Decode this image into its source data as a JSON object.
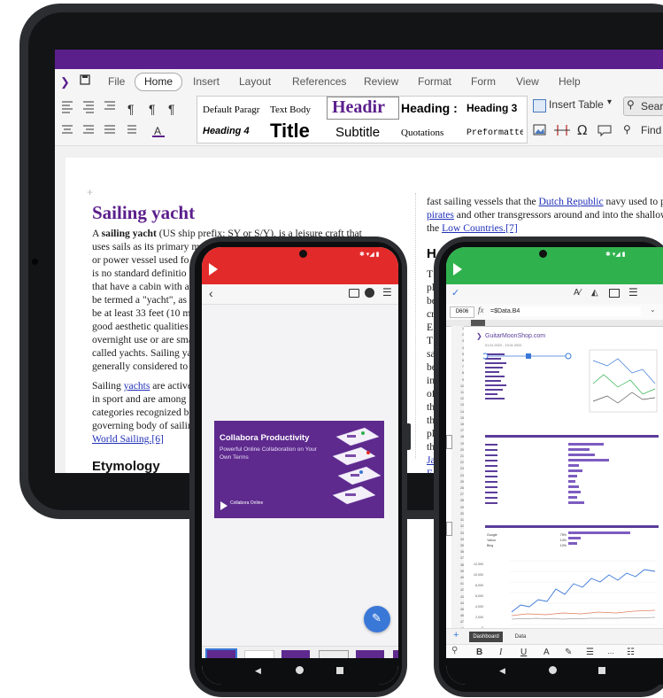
{
  "tablet": {
    "menu": [
      "File",
      "Home",
      "Insert",
      "Layout",
      "References",
      "Review",
      "Format",
      "Form",
      "View",
      "Help"
    ],
    "styles": {
      "default_paragraph": "Default Paragr",
      "text_body": "Text Body",
      "heading": "Headir",
      "heading2": "Heading :",
      "heading3": "Heading 3",
      "heading4": "Heading 4",
      "title": "Title",
      "subtitle": "Subtitle",
      "quotations": "Quotations",
      "preformatted": "Preformatted"
    },
    "insert_table": "Insert Table",
    "search": "Sear",
    "find": "Find",
    "doc": {
      "heading": "Sailing yacht",
      "para1_lines": [
        "A sailing yacht (US ship prefix: SY or S/Y), is a leisure craft that",
        "uses sails as its primary m",
        "or power vessel used fo",
        "is no standard definitio",
        "that have a cabin with a",
        "be termed a \"yacht\", as c",
        "be at least 33 feet (10 m",
        "good aesthetic qualities.",
        "overnight use or are sma",
        "called yachts. Sailing ya",
        "generally considered to"
      ],
      "para2_lines": [
        "Sailing yachts are active",
        "in sport and are among",
        "categories recognized by",
        "governing body of sailin",
        "World Sailing.[6]"
      ],
      "etymology": "Etymology",
      "right_lines": [
        "fast sailing vessels that the Dutch Republic navy used to pu",
        "pirates and other transgressors around and into the shallow",
        "the Low Countries.[7]"
      ],
      "right_heading": "H",
      "right_chars": [
        "T",
        "pl",
        "be",
        "cr",
        "E",
        "T",
        "sa",
        "be",
        "in",
        "of",
        "th",
        "th",
        "pl",
        "th",
        "Ja",
        "E"
      ]
    }
  },
  "phone_left": {
    "slide": {
      "title": "Collabora Productivity",
      "subtitle": "Powerful Online Collaboration on Your Own Terms",
      "logo_text": "Collabora Online"
    },
    "fab_icon": "pencil-icon"
  },
  "phone_right": {
    "cell_ref": "D606",
    "formula": "=$Data.B4",
    "site": "GuitarMoonShop.com",
    "date_range": "01.01.2022 - 13.01.2022",
    "tabs": [
      "Dashboard",
      "Data"
    ],
    "rows": [
      "1",
      "2",
      "3",
      "4",
      "5",
      "6",
      "7",
      "8",
      "9",
      "10",
      "11",
      "12",
      "13",
      "14",
      "15",
      "16",
      "17",
      "18",
      "19",
      "20",
      "21",
      "22",
      "23",
      "24",
      "25",
      "26",
      "27",
      "28",
      "29",
      "30",
      "31",
      "32",
      "33",
      "34",
      "35",
      "36",
      "37",
      "38",
      "39",
      "40",
      "41",
      "42",
      "43",
      "44",
      "45",
      "46",
      "47",
      "48",
      "49"
    ],
    "y_ticks": [
      "12,000",
      "10,000",
      "8,000",
      "6,000",
      "4,000",
      "2,000",
      "0"
    ],
    "sources": [
      "Google",
      "Yahoo",
      "Bing"
    ],
    "source_pcts": [
      "75%",
      "14%",
      "10%"
    ],
    "toolbar": [
      "B",
      "I",
      "U",
      "A"
    ]
  },
  "colors": {
    "brand_purple": "#5b1f8c",
    "red_header": "#e32a2a",
    "green_header": "#2fb24d",
    "fab_blue": "#3a78d8"
  }
}
